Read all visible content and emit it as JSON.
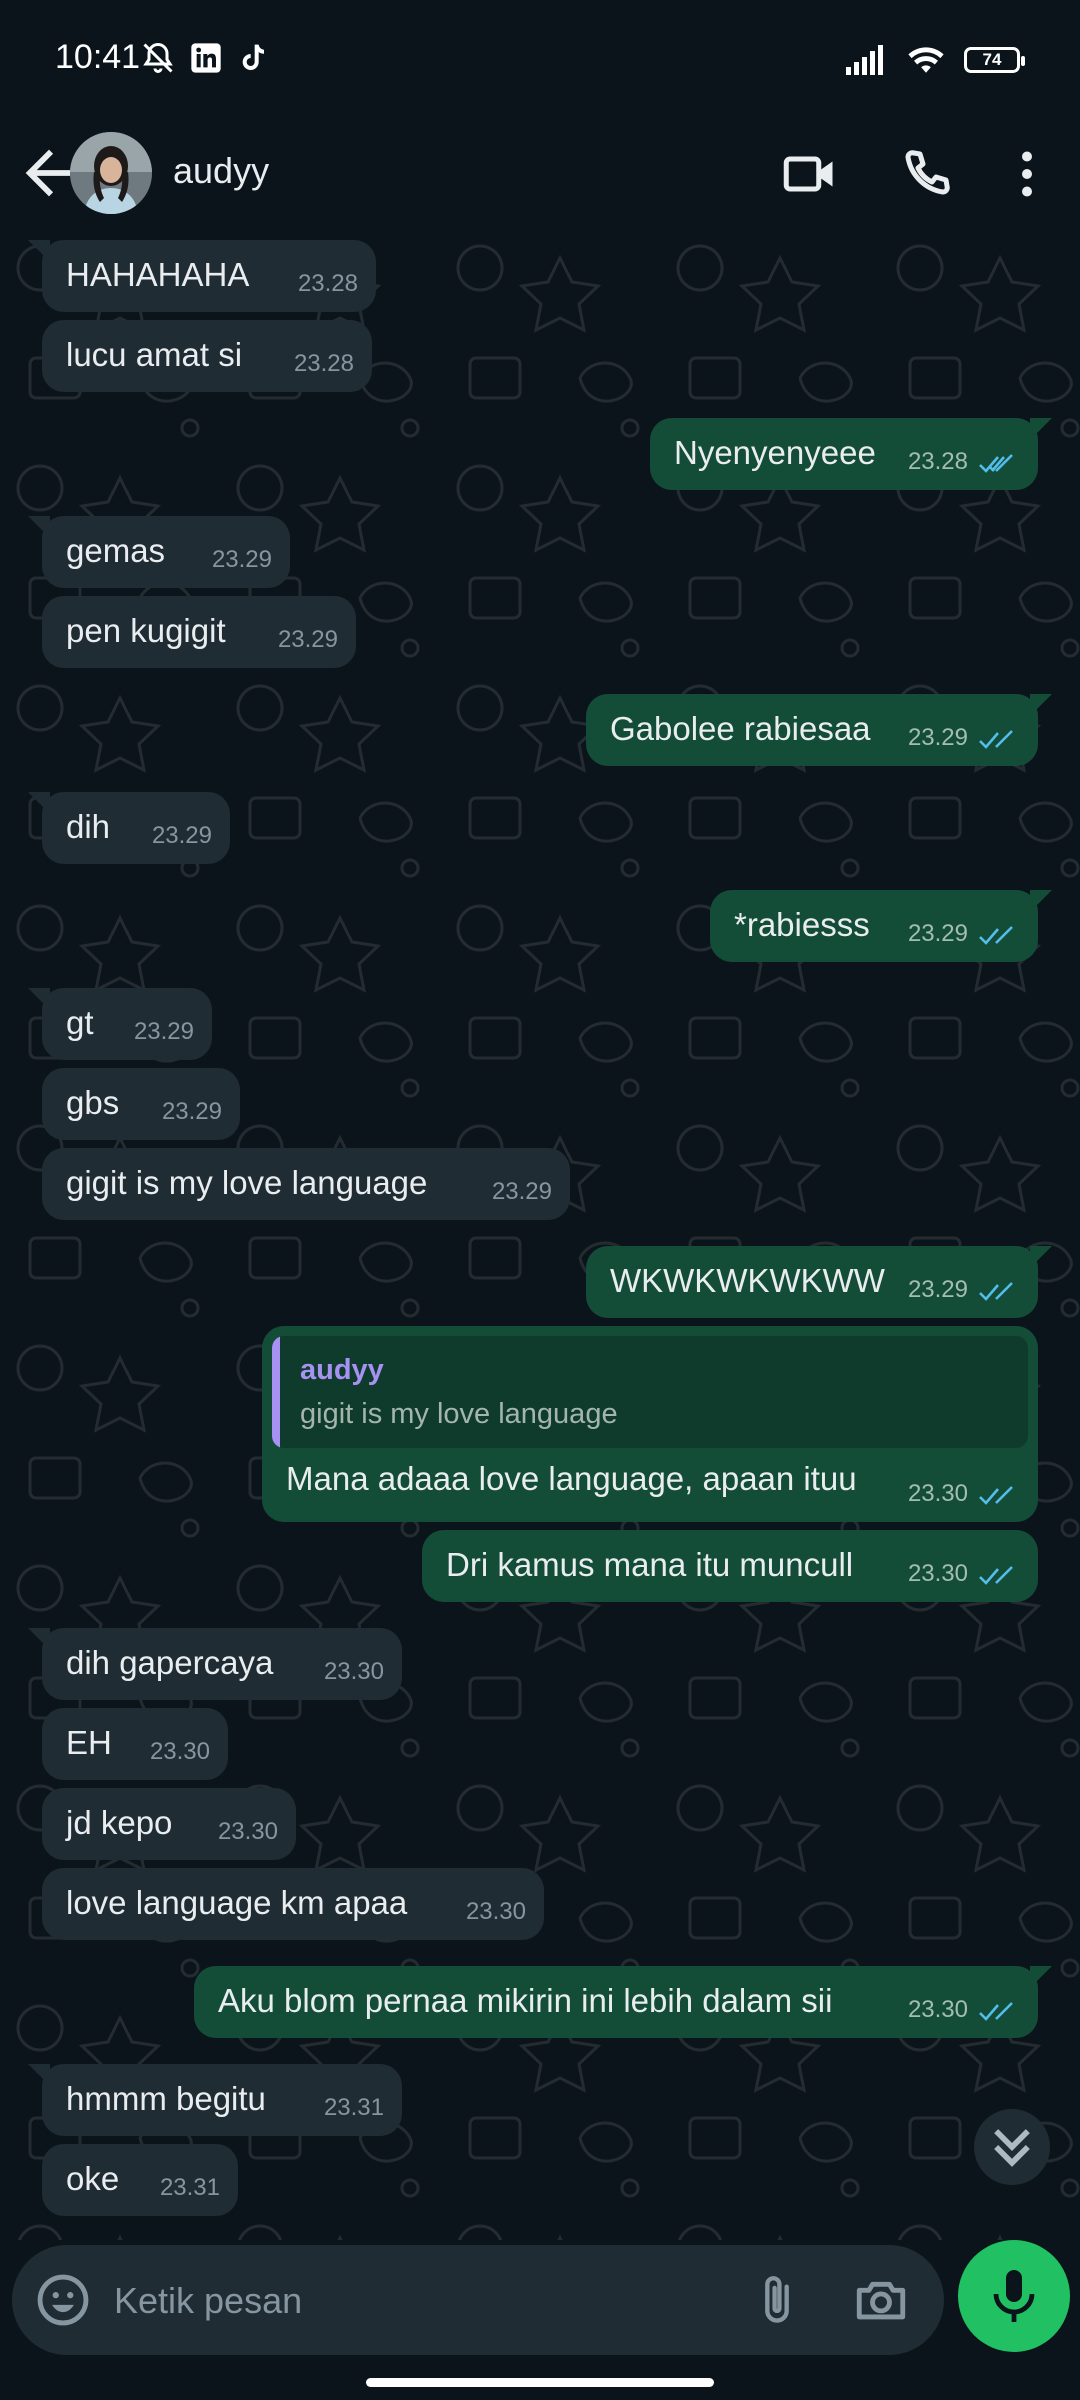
{
  "status_bar": {
    "time": "10:41",
    "battery": "74",
    "icons": [
      "mute-bell-icon",
      "linkedin-icon",
      "tiktok-icon",
      "signal-icon",
      "wifi-icon",
      "battery-icon"
    ]
  },
  "header": {
    "contact_name": "audyy",
    "icons": [
      "back-arrow-icon",
      "avatar",
      "video-call-icon",
      "voice-call-icon",
      "more-vert-icon"
    ]
  },
  "messages": [
    {
      "dir": "in",
      "text": "HAHAHAHA",
      "time": "23.28"
    },
    {
      "dir": "in",
      "text": "lucu amat si",
      "time": "23.28"
    },
    {
      "dir": "out",
      "text": "Nyenyenyeee",
      "time": "23.28",
      "status": "read"
    },
    {
      "dir": "in",
      "text": "gemas",
      "time": "23.29"
    },
    {
      "dir": "in",
      "text": "pen kugigit",
      "time": "23.29"
    },
    {
      "dir": "out",
      "text": "Gabolee rabiesaa",
      "time": "23.29",
      "status": "read"
    },
    {
      "dir": "in",
      "text": "dih",
      "time": "23.29"
    },
    {
      "dir": "out",
      "text": "*rabiesss",
      "time": "23.29",
      "status": "read"
    },
    {
      "dir": "in",
      "text": "gt",
      "time": "23.29"
    },
    {
      "dir": "in",
      "text": "gbs",
      "time": "23.29"
    },
    {
      "dir": "in",
      "text": "gigit is my love language",
      "time": "23.29"
    },
    {
      "dir": "out",
      "text": "WKWKWKWKWW",
      "time": "23.29",
      "status": "read"
    },
    {
      "dir": "out",
      "text": "Mana adaaa love language, apaan ituu",
      "time": "23.30",
      "status": "read",
      "reply": {
        "name": "audyy",
        "text": "gigit is my love language"
      }
    },
    {
      "dir": "out",
      "text": "Dri kamus mana itu muncull",
      "time": "23.30",
      "status": "read"
    },
    {
      "dir": "in",
      "text": "dih gapercaya",
      "time": "23.30"
    },
    {
      "dir": "in",
      "text": "EH",
      "time": "23.30"
    },
    {
      "dir": "in",
      "text": "jd kepo",
      "time": "23.30"
    },
    {
      "dir": "in",
      "text": "love language km apaa",
      "time": "23.30"
    },
    {
      "dir": "out",
      "text": "Aku blom pernaa mikirin ini lebih dalam sii",
      "time": "23.30",
      "status": "read"
    },
    {
      "dir": "in",
      "text": "hmmm begitu",
      "time": "23.31"
    },
    {
      "dir": "in",
      "text": "oke",
      "time": "23.31"
    }
  ],
  "composer": {
    "placeholder": "Ketik pesan",
    "icons": [
      "emoji-icon",
      "attach-icon",
      "camera-icon",
      "mic-icon"
    ]
  },
  "colors": {
    "background": "#0b141a",
    "incoming_bubble": "#202c33",
    "outgoing_bubble": "#144d37",
    "read_ticks": "#53bdeb",
    "mic_button": "#21c063",
    "quote_accent": "#a791f2"
  }
}
